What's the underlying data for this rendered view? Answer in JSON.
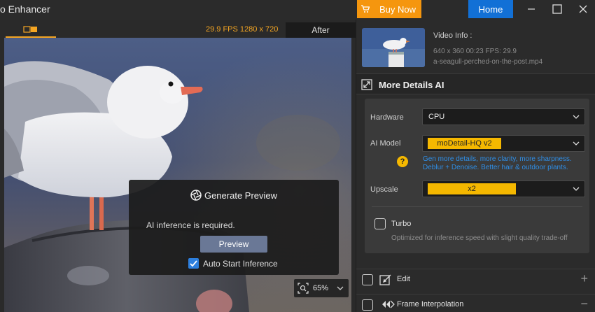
{
  "app": {
    "title": "o Enhancer"
  },
  "titlebar": {
    "buy_now": "Buy Now",
    "home": "Home"
  },
  "preview": {
    "fps_resolution": "29.9 FPS   1280 x 720",
    "after_label": "After"
  },
  "generate_dialog": {
    "title": "Generate Preview",
    "message": "AI inference is required.",
    "preview_button": "Preview",
    "auto_start_label": "Auto Start Inference",
    "auto_start_checked": true
  },
  "zoom": {
    "value": "65%"
  },
  "video_info": {
    "label": "Video Info :",
    "meta": "640 x 360   00:23    FPS: 29.9",
    "filename": "a-seagull-perched-on-the-post.mp4"
  },
  "section": {
    "title": "More Details AI"
  },
  "settings": {
    "hardware_label": "Hardware",
    "hardware_value": "CPU",
    "model_label": "AI Model",
    "model_value": "moDetail-HQ  v2",
    "model_desc_1": "Gen more details, more clarity, more sharpness.",
    "model_desc_2": "Deblur + Denoise. Better hair & outdoor plants.",
    "upscale_label": "Upscale",
    "upscale_value": "x2",
    "turbo_label": "Turbo",
    "turbo_desc": "Optimized for inference speed with slight quality trade-off"
  },
  "features": [
    {
      "label": "Edit",
      "action": "+"
    },
    {
      "label": "Frame Interpolation",
      "action": "−"
    }
  ],
  "colors": {
    "accent_orange": "#f5960e",
    "home_blue": "#1270d6",
    "pill_yellow": "#f5b800",
    "link_blue": "#2f8ee6"
  }
}
